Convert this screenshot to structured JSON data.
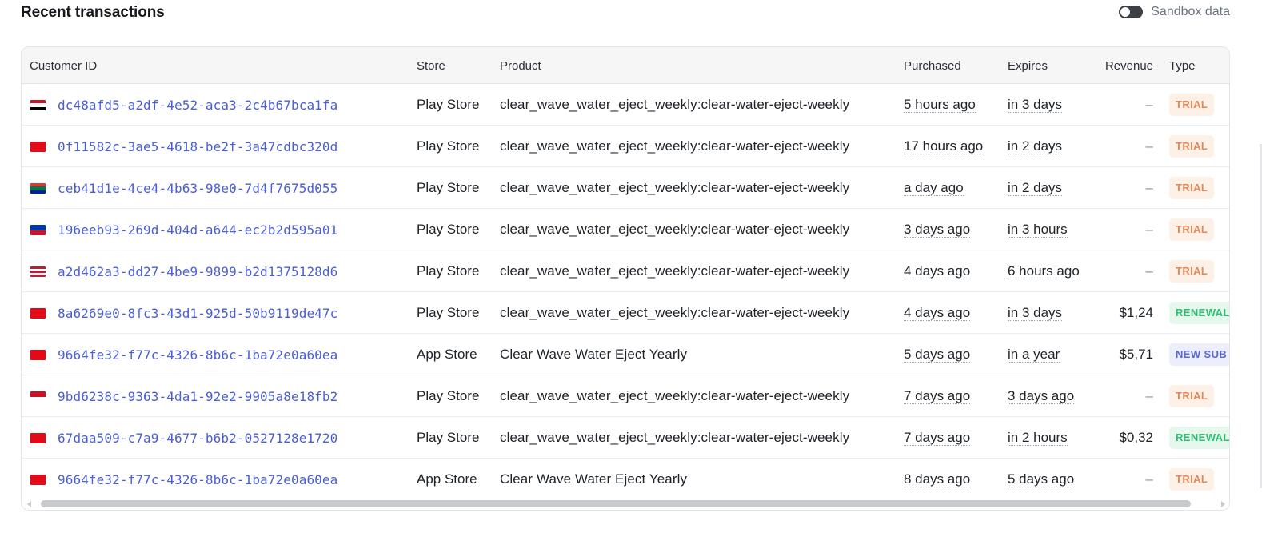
{
  "page": {
    "title": "Recent transactions"
  },
  "sandbox": {
    "label": "Sandbox data",
    "enabled": false
  },
  "table": {
    "columns": {
      "customer_id": "Customer ID",
      "store": "Store",
      "product": "Product",
      "purchased": "Purchased",
      "expires": "Expires",
      "revenue": "Revenue",
      "type": "Type"
    },
    "rows": [
      {
        "flag": [
          "#ce1126",
          "#ffffff",
          "#000000"
        ],
        "customer_id": "dc48afd5-a2df-4e52-aca3-2c4b67bca1fa",
        "store": "Play Store",
        "product": "clear_wave_water_eject_weekly:clear-water-eject-weekly",
        "purchased": "5 hours ago",
        "expires": "in 3 days",
        "revenue": "–",
        "type": "TRIAL"
      },
      {
        "flag": [
          "#e30a17",
          "#e30a17",
          "#e30a17"
        ],
        "customer_id": "0f11582c-3ae5-4618-be2f-3a47cdbc320d",
        "store": "Play Store",
        "product": "clear_wave_water_eject_weekly:clear-water-eject-weekly",
        "purchased": "17 hours ago",
        "expires": "in 2 days",
        "revenue": "–",
        "type": "TRIAL"
      },
      {
        "flag": [
          "#de3831",
          "#007a4d",
          "#002395"
        ],
        "customer_id": "ceb41d1e-4ce4-4b63-98e0-7d4f7675d055",
        "store": "Play Store",
        "product": "clear_wave_water_eject_weekly:clear-water-eject-weekly",
        "purchased": "a day ago",
        "expires": "in 2 days",
        "revenue": "–",
        "type": "TRIAL"
      },
      {
        "flag": [
          "#0038a8",
          "#ce1126"
        ],
        "customer_id": "196eeb93-269d-404d-a644-ec2b2d595a01",
        "store": "Play Store",
        "product": "clear_wave_water_eject_weekly:clear-water-eject-weekly",
        "purchased": "3 days ago",
        "expires": "in 3 hours",
        "revenue": "–",
        "type": "TRIAL"
      },
      {
        "flag": [
          "#b22234",
          "#ffffff",
          "#b22234",
          "#ffffff",
          "#b22234"
        ],
        "customer_id": "a2d462a3-dd27-4be9-9899-b2d1375128d6",
        "store": "Play Store",
        "product": "clear_wave_water_eject_weekly:clear-water-eject-weekly",
        "purchased": "4 days ago",
        "expires": "6 hours ago",
        "revenue": "–",
        "type": "TRIAL"
      },
      {
        "flag": [
          "#e30a17",
          "#e30a17",
          "#e30a17"
        ],
        "customer_id": "8a6269e0-8fc3-43d1-925d-50b9119de47c",
        "store": "Play Store",
        "product": "clear_wave_water_eject_weekly:clear-water-eject-weekly",
        "purchased": "4 days ago",
        "expires": "in 3 days",
        "revenue": "$1,24",
        "type": "RENEWAL"
      },
      {
        "flag": [
          "#e30a17",
          "#e30a17",
          "#e30a17"
        ],
        "customer_id": "9664fe32-f77c-4326-8b6c-1ba72e0a60ea",
        "store": "App Store",
        "product": "Clear Wave Water Eject Yearly",
        "purchased": "5 days ago",
        "expires": "in a year",
        "revenue": "$5,71",
        "type": "NEW SUB"
      },
      {
        "flag": [
          "#ce1126",
          "#ffffff"
        ],
        "customer_id": "9bd6238c-9363-4da1-92e2-9905a8e18fb2",
        "store": "Play Store",
        "product": "clear_wave_water_eject_weekly:clear-water-eject-weekly",
        "purchased": "7 days ago",
        "expires": "3 days ago",
        "revenue": "–",
        "type": "TRIAL"
      },
      {
        "flag": [
          "#e30a17",
          "#e30a17",
          "#e30a17"
        ],
        "customer_id": "67daa509-c7a9-4677-b6b2-0527128e1720",
        "store": "Play Store",
        "product": "clear_wave_water_eject_weekly:clear-water-eject-weekly",
        "purchased": "7 days ago",
        "expires": "in 2 hours",
        "revenue": "$0,32",
        "type": "RENEWAL"
      },
      {
        "flag": [
          "#e30a17",
          "#e30a17",
          "#e30a17"
        ],
        "customer_id": "9664fe32-f77c-4326-8b6c-1ba72e0a60ea",
        "store": "App Store",
        "product": "Clear Wave Water Eject Yearly",
        "purchased": "8 days ago",
        "expires": "5 days ago",
        "revenue": "–",
        "type": "TRIAL"
      }
    ]
  }
}
